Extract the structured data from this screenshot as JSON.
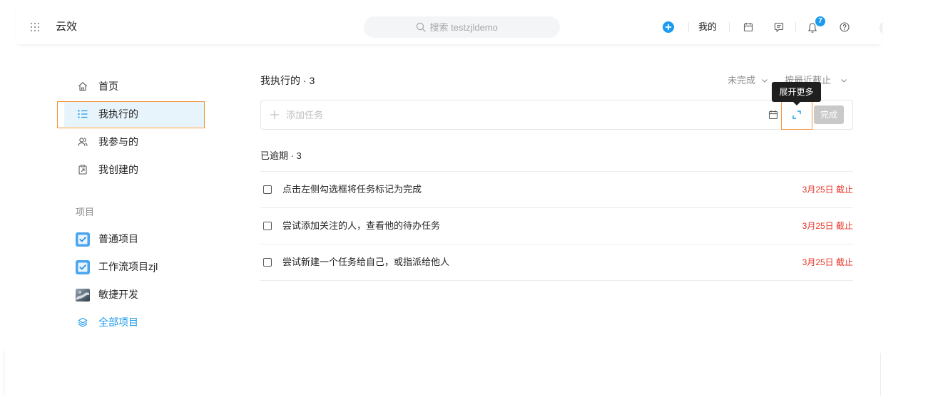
{
  "header": {
    "app_name": "云效",
    "search_placeholder": "搜索 testzjldemo",
    "my_label": "我的",
    "notification_count": "7",
    "icons": [
      "grid-icon",
      "search-icon",
      "plus-circle-icon",
      "calendar-icon",
      "message-icon",
      "bell-icon",
      "question-icon"
    ]
  },
  "sidebar": {
    "nav": [
      {
        "label": "首页",
        "icon": "home-icon"
      },
      {
        "label": "我执行的",
        "icon": "list-icon",
        "selected": true
      },
      {
        "label": "我参与的",
        "icon": "people-icon"
      },
      {
        "label": "我创建的",
        "icon": "clipboard-icon"
      }
    ],
    "projects_heading": "项目",
    "projects": [
      {
        "label": "普通项目",
        "icon": "project-check-icon"
      },
      {
        "label": "工作流项目zjl",
        "icon": "project-check-icon"
      },
      {
        "label": "敏捷开发",
        "icon": "project-cover-image-icon"
      }
    ],
    "all_projects": {
      "label": "全部项目",
      "icon": "layers-icon"
    }
  },
  "main": {
    "heading": "我执行的 · 3",
    "filter_status": "未完成",
    "sort_order": "按最近截止",
    "tooltip": "展开更多",
    "add_task": {
      "placeholder": "添加任务",
      "done_button": "完成"
    },
    "overdue_group": {
      "heading": "已逾期 · 3",
      "tasks": [
        {
          "title": "点击左侧勾选框将任务标记为完成",
          "due": "3月25日 截止",
          "done": false
        },
        {
          "title": "尝试添加关注的人，查看他的待办任务",
          "due": "3月25日 截止",
          "done": false
        },
        {
          "title": "尝试新建一个任务给自己，或指派给他人",
          "due": "3月25日 截止",
          "done": false
        }
      ]
    }
  },
  "colors": {
    "accent": "#1b9aee",
    "overdue_red": "#e8372a",
    "selected_bg": "#e8f4fc",
    "annotation_orange": "#f39236",
    "tooltip_bg": "#1f1f1f"
  }
}
